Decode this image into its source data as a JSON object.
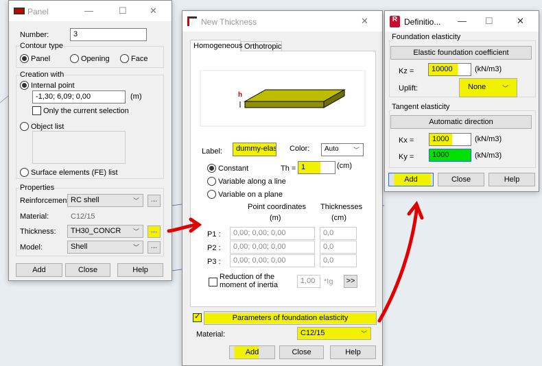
{
  "panel": {
    "title": "Panel",
    "number_label": "Number:",
    "number_value": "3",
    "contour_type": {
      "label": "Contour type",
      "options": [
        "Panel",
        "Opening",
        "Face"
      ],
      "selected": "Panel"
    },
    "creation": {
      "label": "Creation with",
      "internal_point": "Internal point",
      "point_value": "-1,30; 6,09; 0,00",
      "unit": "(m)",
      "only_selection": "Only the current selection",
      "object_list": "Object list",
      "surface_elements": "Surface elements (FE) list"
    },
    "properties": {
      "label": "Properties",
      "reinforcement_label": "Reinforcement",
      "reinforcement_value": "RC shell",
      "material_label": "Material:",
      "material_value": "C12/15",
      "thickness_label": "Thickness:",
      "thickness_value": "TH30_CONCR",
      "model_label": "Model:",
      "model_value": "Shell",
      "more": "..."
    },
    "buttons": {
      "add": "Add",
      "close": "Close",
      "help": "Help"
    }
  },
  "thickness": {
    "title": "New Thickness",
    "tabs": [
      "Homogeneous",
      "Orthotropic"
    ],
    "diagram_h": "h",
    "label_label": "Label:",
    "label_value": "dummy-elas",
    "color_label": "Color:",
    "color_value": "Auto",
    "constant": "Constant",
    "variable_line": "Variable along a line",
    "variable_plane": "Variable on a plane",
    "th_label": "Th =",
    "th_value": "1",
    "th_unit": "(cm)",
    "col_coords": "Point coordinates",
    "col_coords_unit": "(m)",
    "col_thick": "Thicknesses",
    "col_thick_unit": "(cm)",
    "points": [
      {
        "name": "P1 :",
        "coords": "0,00; 0,00; 0,00",
        "thick": "0,0"
      },
      {
        "name": "P2 :",
        "coords": "0,00; 0,00; 0,00",
        "thick": "0,0"
      },
      {
        "name": "P3 :",
        "coords": "0,00; 0,00; 0,00",
        "thick": "0,0"
      }
    ],
    "reduction_line1": "Reduction of the",
    "reduction_line2": "moment of inertia",
    "reduction_value": "1,00",
    "reduction_unit": "*Ig",
    "expand": ">>",
    "foundation_button": "Parameters of foundation elasticity",
    "material_label": "Material:",
    "material_value": "C12/15",
    "buttons": {
      "add": "Add",
      "close": "Close",
      "help": "Help"
    }
  },
  "definition": {
    "title": "Definitio...",
    "app_icon": "R",
    "foundation_group": "Foundation elasticity",
    "elastic_button": "Elastic foundation coefficient",
    "kz_label": "Kz =",
    "kz_value": "10000",
    "unit": "(kN/m3)",
    "uplift_label": "Uplift:",
    "uplift_value": "None",
    "tangent_group": "Tangent elasticity",
    "auto_button": "Automatic direction",
    "kx_label": "Kx =",
    "kx_value": "1000",
    "ky_label": "Ky =",
    "ky_value": "1000",
    "buttons": {
      "add": "Add",
      "close": "Close",
      "help": "Help"
    }
  },
  "colors": {
    "highlight": "#f2f200",
    "arrow": "#e00000",
    "active_field": "#00e000"
  }
}
